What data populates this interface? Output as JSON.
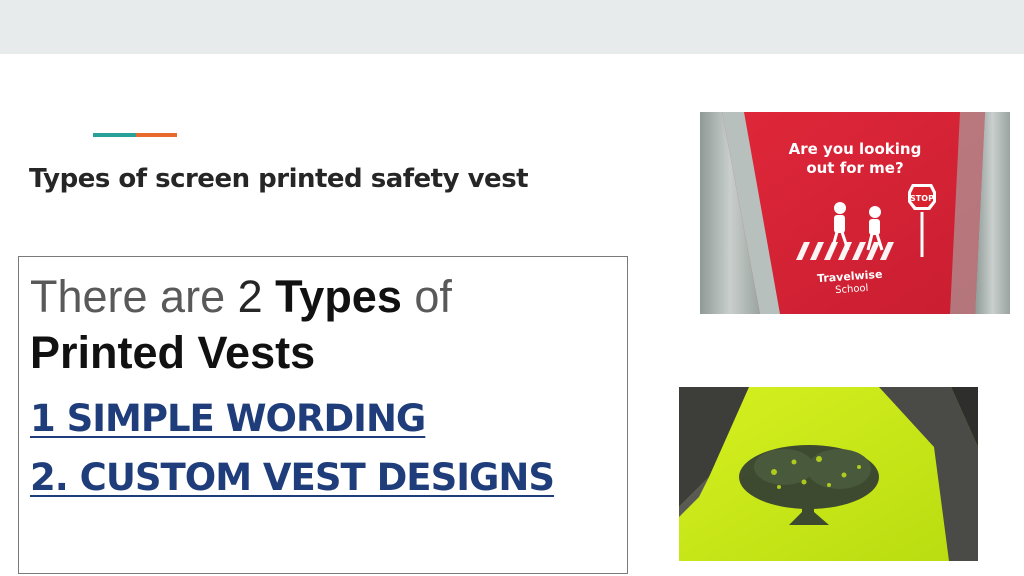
{
  "slide": {
    "title": "Types of screen printed safety vest",
    "intro": {
      "part1": "There are ",
      "part2": "2 ",
      "part3": "Types",
      "part4": " of",
      "part5": "Printed Vests"
    },
    "items": [
      "1 SIMPLE WORDING",
      "2. CUSTOM VEST DESIGNS"
    ],
    "accent_colors": [
      "#2aa198",
      "#e8692e"
    ],
    "link_color": "#1f3d7a"
  },
  "images": {
    "red_vest": {
      "print_line1": "Are you looking",
      "print_line2": "out for me?",
      "sign": "STOP",
      "school_line1": "Travelwise",
      "school_line2": "School"
    },
    "yellow_vest": {
      "print": "tree-icon"
    }
  }
}
